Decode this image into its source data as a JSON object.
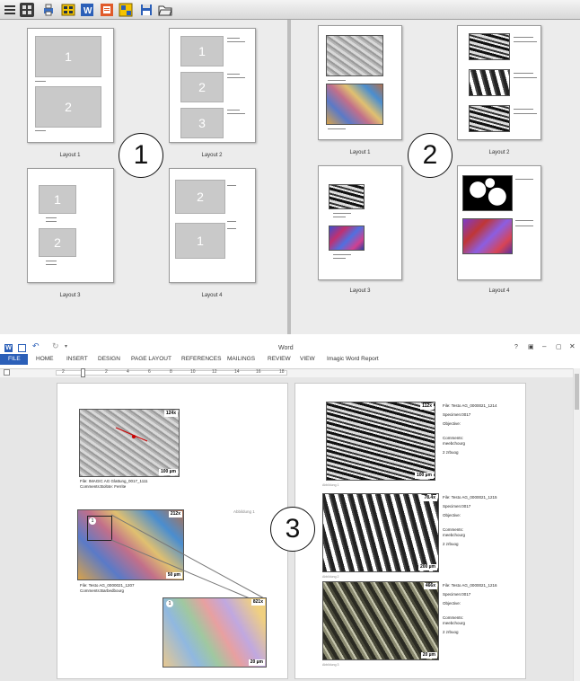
{
  "toolbar": {
    "icons": [
      "menu-icon",
      "grid-icon",
      "print-icon",
      "layout-icon",
      "word-icon",
      "report-icon",
      "multi-layout-icon",
      "save-icon",
      "open-folder-icon"
    ]
  },
  "panel1": {
    "badge": "1",
    "layouts": [
      "Layout 1",
      "Layout 2",
      "Layout 3",
      "Layout 4"
    ],
    "l1_nums": [
      "1",
      "2"
    ],
    "l2_nums": [
      "1",
      "2",
      "3"
    ],
    "l3_nums": [
      "1",
      "2"
    ],
    "l4_nums": [
      "2",
      "1"
    ]
  },
  "panel2": {
    "badge": "2",
    "layouts": [
      "Layout 1",
      "Layout 2",
      "Layout 3",
      "Layout 4"
    ]
  },
  "word": {
    "title": "Word",
    "menu": [
      "FILE",
      "HOME",
      "INSERT",
      "DESIGN",
      "PAGE LAYOUT",
      "REFERENCES",
      "MAILINGS",
      "REVIEW",
      "VIEW",
      "Imagic Word Report"
    ],
    "ruler": [
      "2",
      "2",
      "4",
      "6",
      "8",
      "10",
      "12",
      "14",
      "16",
      "18"
    ],
    "badge": "3",
    "left_page": {
      "img1_zoom": "124x",
      "img1_scale": "100 µm",
      "cap1": [
        "File: IMAGIC AG Glattung_0017_1111",
        "Comments:Bolt4e: Ferrite"
      ],
      "img2_zoom": "212x",
      "img2_scale": "50 µm",
      "img2_marker": "1",
      "cap2": [
        "File: Testo AG_0000021_1207",
        "Comments:Barbedbourg"
      ],
      "side_note": "Abbildung 1",
      "img3_zoom": "821x",
      "img3_scale": "20 µm",
      "img3_marker": "1"
    },
    "right_page": {
      "images": [
        {
          "zoom": "112x",
          "scale": "100 µm",
          "lines": [
            "File: Testo AG_0000021_1214",
            "Specimen:0017",
            "Objective:",
            "",
            "Comments:",
            "meebchourg",
            "2 zrbuog"
          ],
          "fig": "Abbildung 1"
        },
        {
          "zoom": "78.4x",
          "scale": "200 µm",
          "lines": [
            "File: Testo AG_0000021_1215",
            "Specimen:0017",
            "Objective:",
            "",
            "Comments:",
            "meebchourg",
            "2 zrbuog"
          ],
          "fig": "Abbildung 2"
        },
        {
          "zoom": "466x",
          "scale": "20 µm",
          "lines": [
            "File: Testo AG_0000021_1216",
            "Specimen:0017",
            "Objective:",
            "",
            "Comments:",
            "meebchourg",
            "2 zrbuog"
          ],
          "fig": "Abbildung 3"
        }
      ]
    }
  }
}
